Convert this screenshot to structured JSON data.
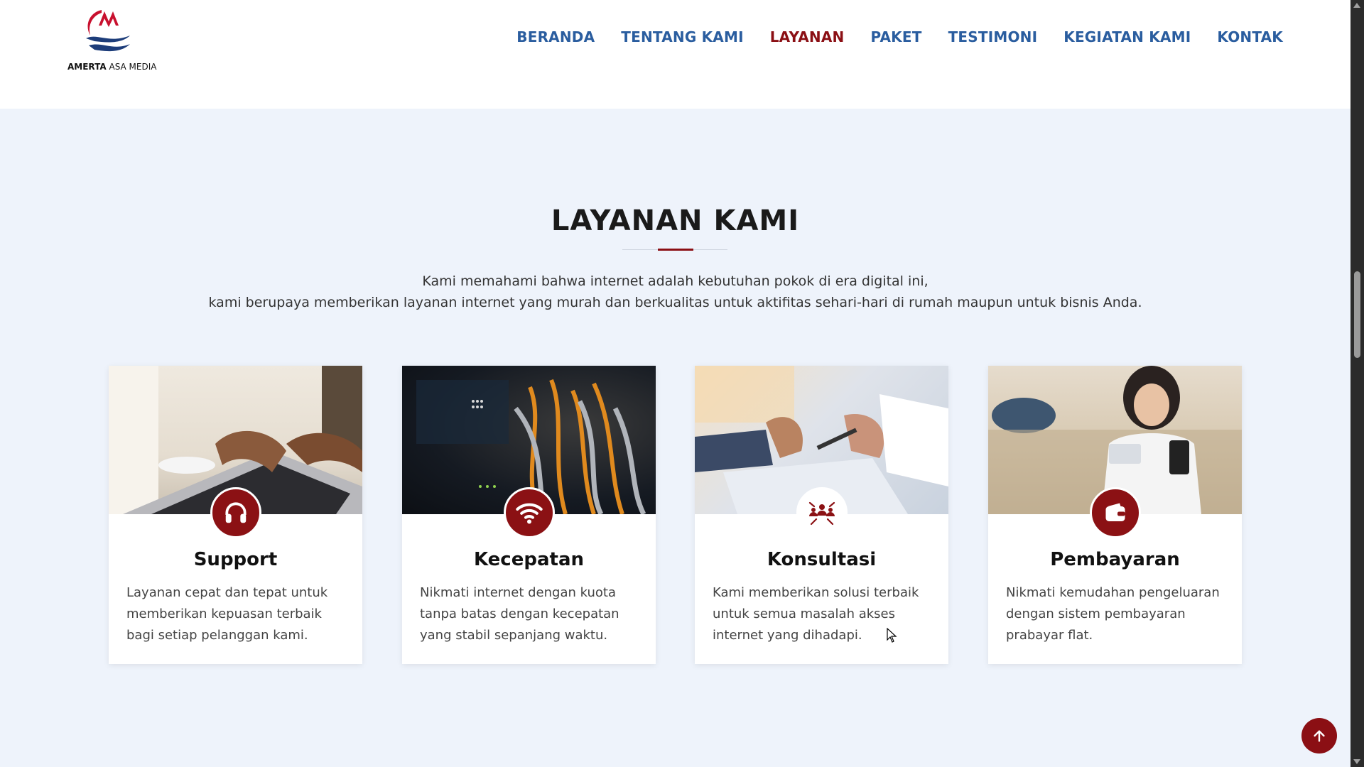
{
  "brand": {
    "name_bold": "AMERTA",
    "name_rest": " ASA MEDIA",
    "primary_color": "#8b0f14",
    "nav_color": "#2a5d9f"
  },
  "nav": {
    "items": [
      {
        "label": "BERANDA"
      },
      {
        "label": "TENTANG KAMI"
      },
      {
        "label": "LAYANAN",
        "active": true
      },
      {
        "label": "PAKET"
      },
      {
        "label": "TESTIMONI"
      },
      {
        "label": "KEGIATAN KAMI"
      },
      {
        "label": "KONTAK"
      }
    ]
  },
  "services": {
    "title": "LAYANAN KAMI",
    "intro_line1": "Kami memahami bahwa internet adalah kebutuhan pokok di era digital ini,",
    "intro_line2": "kami berupaya memberikan layanan internet yang murah dan berkualitas untuk aktifitas sehari-hari di rumah maupun untuk bisnis Anda.",
    "cards": [
      {
        "title": "Support",
        "icon": "headphones-icon",
        "description": "Layanan cepat dan tepat untuk memberikan kepuasan terbaik bagi setiap pelanggan kami."
      },
      {
        "title": "Kecepatan",
        "icon": "wifi-icon",
        "description": "Nikmati internet dengan kuota tanpa batas dengan kecepatan yang stabil sepanjang waktu."
      },
      {
        "title": "Konsultasi",
        "icon": "people-network-icon",
        "description": "Kami memberikan solusi terbaik untuk semua masalah akses internet yang dihadapi."
      },
      {
        "title": "Pembayaran",
        "icon": "wallet-icon",
        "description": "Nikmati kemudahan pengeluaran dengan sistem pembayaran prabayar flat."
      }
    ]
  },
  "scroll_top": {
    "icon": "arrow-up-icon"
  }
}
